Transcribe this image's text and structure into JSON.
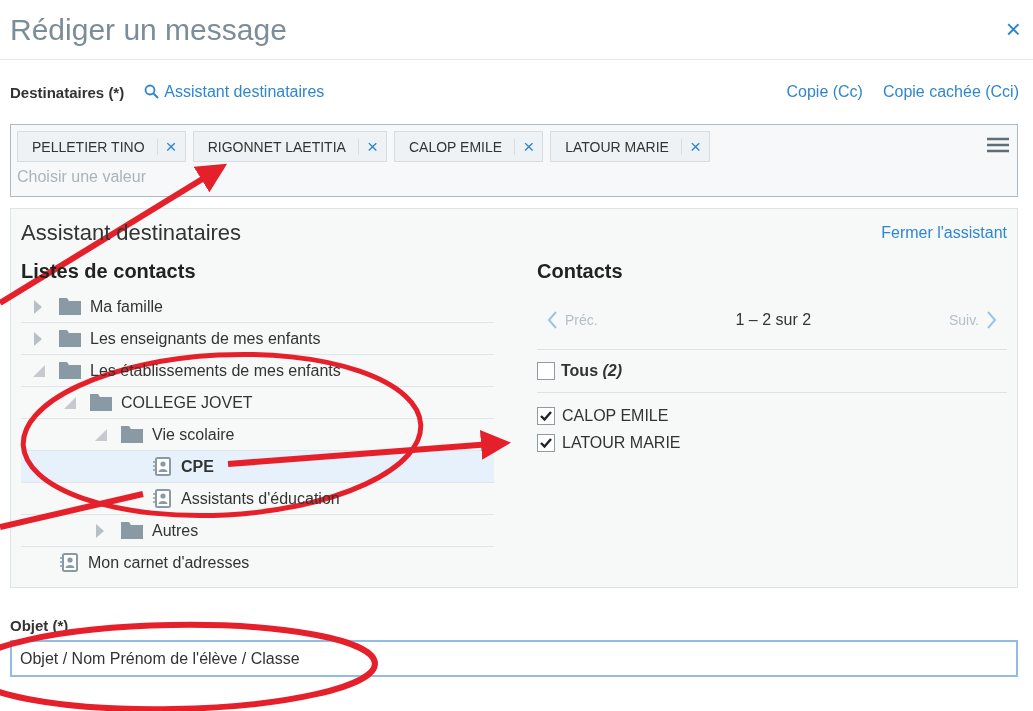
{
  "window": {
    "title": "Rédiger un message",
    "close": "×"
  },
  "recipients": {
    "label": "Destinataires (*)",
    "assistant_link": "Assistant destinataires",
    "cc_link": "Copie (Cc)",
    "bcc_link": "Copie cachée (Cci)",
    "placeholder": "Choisir une valeur",
    "tags": [
      {
        "name": "PELLETIER TINO",
        "remove": "×"
      },
      {
        "name": "RIGONNET LAETITIA",
        "remove": "×"
      },
      {
        "name": "CALOP EMILE",
        "remove": "×"
      },
      {
        "name": "LATOUR MARIE",
        "remove": "×"
      }
    ]
  },
  "assistant": {
    "title": "Assistant destinataires",
    "close_link": "Fermer l'assistant",
    "lists_heading": "Listes de contacts",
    "tree": [
      {
        "label": "Ma famille",
        "kind": "folder",
        "expanded": false,
        "selected": false
      },
      {
        "label": "Les enseignants de mes enfants",
        "kind": "folder",
        "expanded": false,
        "selected": false
      },
      {
        "label": "Les établissements de mes enfants",
        "kind": "folder",
        "expanded": true,
        "selected": false,
        "children": [
          {
            "label": "COLLEGE JOVET",
            "kind": "folder",
            "expanded": true,
            "selected": false,
            "children": [
              {
                "label": "Vie scolaire",
                "kind": "folder",
                "expanded": true,
                "selected": false,
                "children": [
                  {
                    "label": "CPE",
                    "kind": "addressbook",
                    "selected": true
                  },
                  {
                    "label": "Assistants d'éducation",
                    "kind": "addressbook",
                    "selected": false
                  }
                ]
              },
              {
                "label": "Autres",
                "kind": "folder",
                "expanded": false,
                "selected": false
              }
            ]
          }
        ]
      },
      {
        "label": "Mon carnet d'adresses",
        "kind": "addressbook",
        "selected": false
      }
    ],
    "contacts_heading": "Contacts",
    "pager": {
      "prev": "Préc.",
      "range": "1 – 2 sur 2",
      "next": "Suiv.",
      "prev_disabled": true,
      "next_disabled": true
    },
    "all": {
      "label": "Tous *(2)*",
      "checked": false
    },
    "contacts": [
      {
        "name": "CALOP EMILE",
        "checked": true
      },
      {
        "name": "LATOUR MARIE",
        "checked": true
      }
    ]
  },
  "subject": {
    "label": "Objet (*)",
    "value": "Objet / Nom Prénom de l'élève / Classe"
  }
}
